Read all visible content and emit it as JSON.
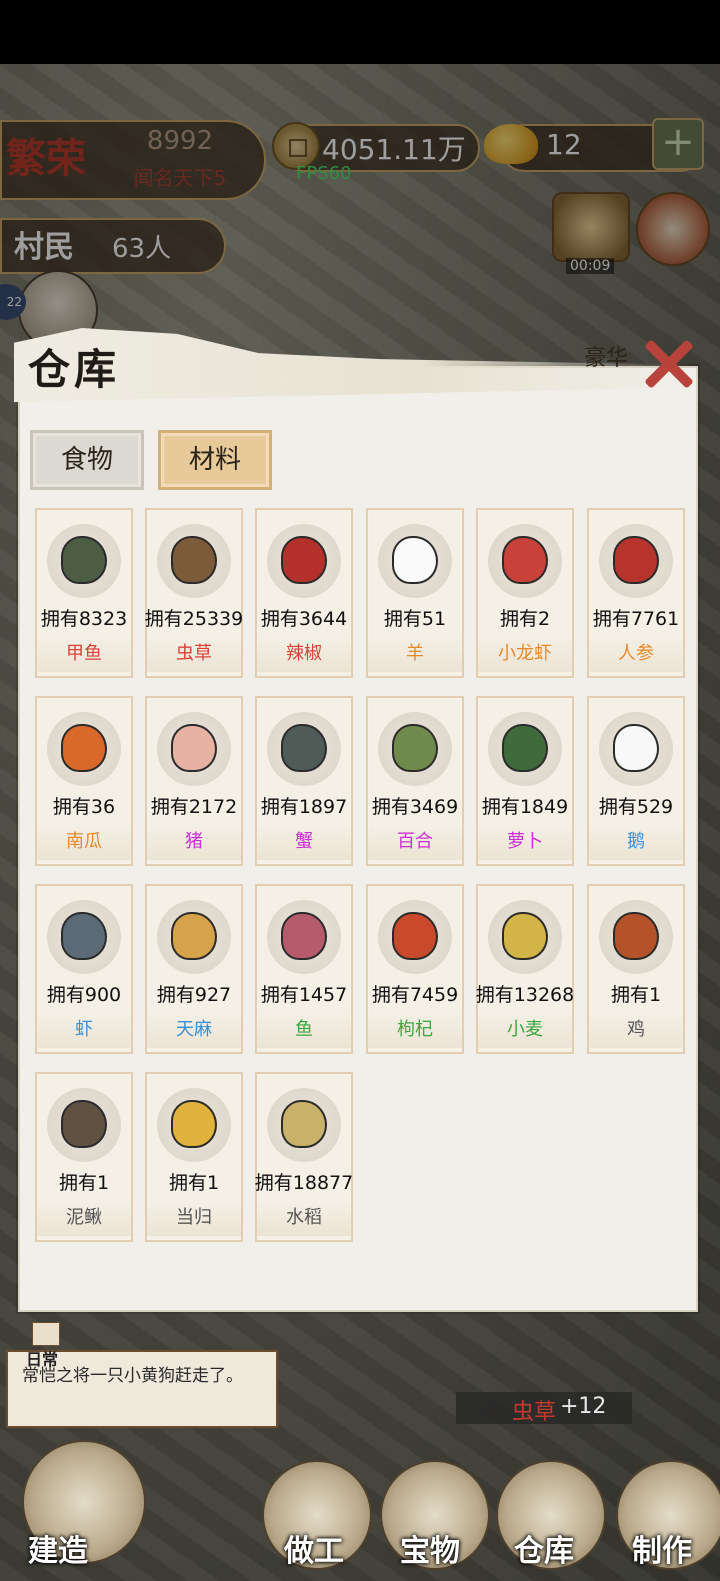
{
  "hud": {
    "prosperity_title": "繁荣",
    "prosperity_value": "8992",
    "prosperity_rank": "闻名天下5",
    "coins": "4051.11万",
    "fps": "FPS60",
    "gold": "12",
    "plus": "+",
    "villager_label": "村民",
    "villager_count": "63人",
    "timer": "00:09",
    "side_badge": "22",
    "hao_label": "豪华"
  },
  "panel": {
    "title": "仓库",
    "tabs": [
      {
        "label": "食物",
        "active": false
      },
      {
        "label": "材料",
        "active": true
      }
    ],
    "items": [
      {
        "owned": "拥有8323",
        "name": "甲鱼",
        "color": "#d9423a",
        "icon": "turtle-icon"
      },
      {
        "owned": "拥有25339",
        "name": "虫草",
        "color": "#d9423a",
        "icon": "cordyceps-icon"
      },
      {
        "owned": "拥有3644",
        "name": "辣椒",
        "color": "#d9423a",
        "icon": "chili-icon"
      },
      {
        "owned": "拥有51",
        "name": "羊",
        "color": "#e58a2a",
        "icon": "goat-icon"
      },
      {
        "owned": "拥有2",
        "name": "小龙虾",
        "color": "#e58a2a",
        "icon": "crayfish-icon"
      },
      {
        "owned": "拥有7761",
        "name": "人参",
        "color": "#e58a2a",
        "icon": "ginseng-icon"
      },
      {
        "owned": "拥有36",
        "name": "南瓜",
        "color": "#e58a2a",
        "icon": "pumpkin-icon"
      },
      {
        "owned": "拥有2172",
        "name": "猪",
        "color": "#cc2fd6",
        "icon": "pig-icon"
      },
      {
        "owned": "拥有1897",
        "name": "蟹",
        "color": "#cc2fd6",
        "icon": "crab-icon"
      },
      {
        "owned": "拥有3469",
        "name": "百合",
        "color": "#cc2fd6",
        "icon": "lily-icon"
      },
      {
        "owned": "拥有1849",
        "name": "萝卜",
        "color": "#cc2fd6",
        "icon": "radish-icon"
      },
      {
        "owned": "拥有529",
        "name": "鹅",
        "color": "#3a8fd8",
        "icon": "goose-icon"
      },
      {
        "owned": "拥有900",
        "name": "虾",
        "color": "#3a8fd8",
        "icon": "shrimp-icon"
      },
      {
        "owned": "拥有927",
        "name": "天麻",
        "color": "#3a8fd8",
        "icon": "gastrodia-icon"
      },
      {
        "owned": "拥有1457",
        "name": "鱼",
        "color": "#3aa63f",
        "icon": "fish-icon"
      },
      {
        "owned": "拥有7459",
        "name": "枸杞",
        "color": "#3aa63f",
        "icon": "goji-icon"
      },
      {
        "owned": "拥有13268",
        "name": "小麦",
        "color": "#3aa63f",
        "icon": "wheat-icon"
      },
      {
        "owned": "拥有1",
        "name": "鸡",
        "color": "#555555",
        "icon": "rooster-icon"
      },
      {
        "owned": "拥有1",
        "name": "泥鳅",
        "color": "#555555",
        "icon": "loach-icon"
      },
      {
        "owned": "拥有1",
        "name": "当归",
        "color": "#555555",
        "icon": "angelica-icon"
      },
      {
        "owned": "拥有18877",
        "name": "水稻",
        "color": "#555555",
        "icon": "rice-icon"
      }
    ]
  },
  "log": {
    "tag": "日常",
    "text": "常恺之将一只小黄狗赶走了。"
  },
  "toast": {
    "item": "虫草",
    "delta": "+12"
  },
  "nav": [
    {
      "label": "建造",
      "icon": "build-icon"
    },
    {
      "label": "做工",
      "icon": "work-icon"
    },
    {
      "label": "宝物",
      "icon": "treasure-icon"
    },
    {
      "label": "仓库",
      "icon": "warehouse-icon"
    },
    {
      "label": "制作",
      "icon": "craft-icon"
    }
  ]
}
